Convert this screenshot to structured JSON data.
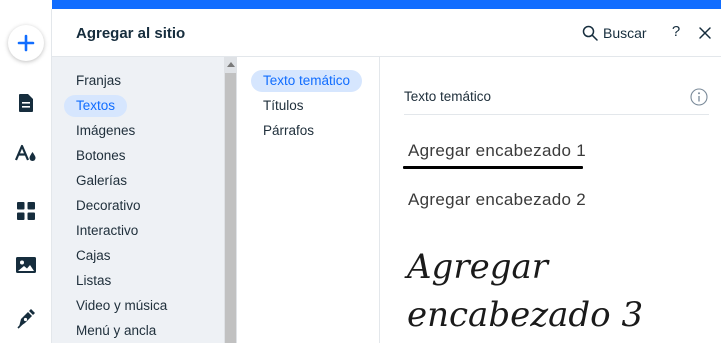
{
  "left_rail": {
    "items": [
      {
        "name": "add",
        "icon": "plus-icon"
      },
      {
        "name": "pages",
        "icon": "page-icon"
      },
      {
        "name": "design",
        "icon": "text-style-icon"
      },
      {
        "name": "apps",
        "icon": "apps-grid-icon"
      },
      {
        "name": "media",
        "icon": "image-icon"
      },
      {
        "name": "blog",
        "icon": "pen-icon"
      }
    ],
    "accent_color": "#116dff"
  },
  "panel": {
    "title": "Agregar al sitio",
    "search_label": "Buscar",
    "help_label": "?",
    "close_icon": "close-icon"
  },
  "categories": [
    {
      "label": "Franjas",
      "selected": false
    },
    {
      "label": "Textos",
      "selected": true
    },
    {
      "label": "Imágenes",
      "selected": false
    },
    {
      "label": "Botones",
      "selected": false
    },
    {
      "label": "Galerías",
      "selected": false
    },
    {
      "label": "Decorativo",
      "selected": false
    },
    {
      "label": "Interactivo",
      "selected": false
    },
    {
      "label": "Cajas",
      "selected": false
    },
    {
      "label": "Listas",
      "selected": false
    },
    {
      "label": "Video y música",
      "selected": false
    },
    {
      "label": "Menú y ancla",
      "selected": false
    }
  ],
  "subcategories": [
    {
      "label": "Texto temático",
      "selected": true
    },
    {
      "label": "Títulos",
      "selected": false
    },
    {
      "label": "Párrafos",
      "selected": false
    }
  ],
  "content": {
    "section_title": "Texto temático",
    "info_icon": "info-icon",
    "headings": [
      "Agregar encabezado 1",
      "Agregar encabezado 2",
      "Agregar encabezado 3"
    ]
  },
  "colors": {
    "selected_bg": "#d6e6fe",
    "selected_text": "#116dff",
    "category_bg": "#eef1f5"
  }
}
